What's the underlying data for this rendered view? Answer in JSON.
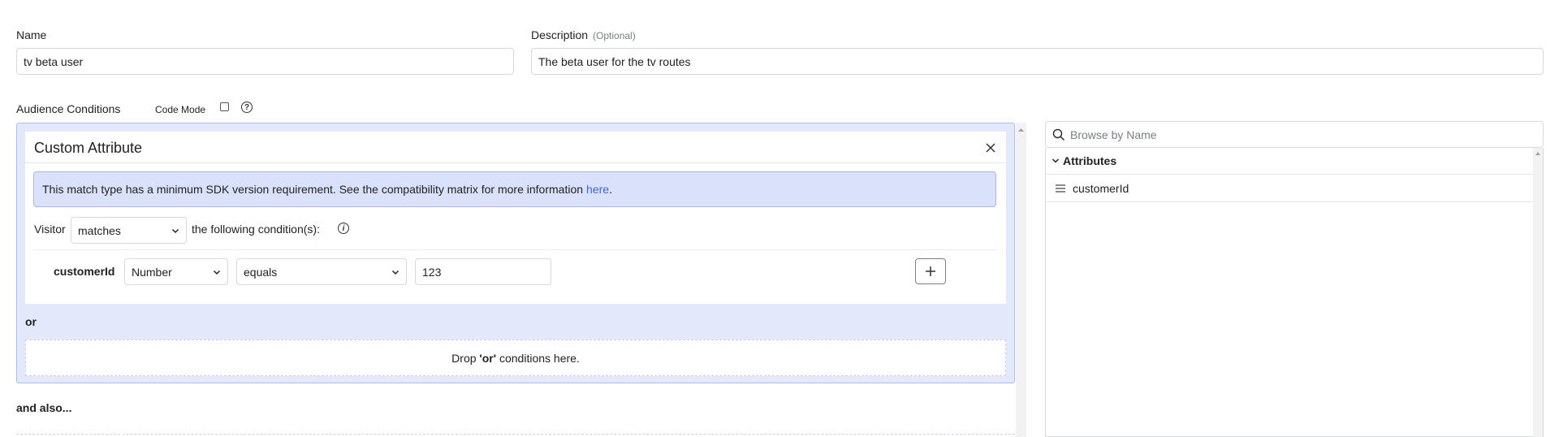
{
  "name_field": {
    "label": "Name",
    "value": "tv beta user"
  },
  "description_field": {
    "label": "Description",
    "optional_note": "(Optional)",
    "value": "The beta user for the tv routes"
  },
  "audience": {
    "label": "Audience Conditions",
    "code_mode_label": "Code Mode",
    "help_glyph": "?"
  },
  "condition_card": {
    "title": "Custom Attribute",
    "notice_text": "This match type has a minimum SDK version requirement. See the compatibility matrix for more information",
    "notice_link": "here",
    "notice_end": ".",
    "visitor_label": "Visitor",
    "match_select": "matches",
    "following_label": "the following condition(s):",
    "info_glyph": "i",
    "row": {
      "attribute": "customerId",
      "type_select": "Number",
      "operator_select": "equals",
      "value": "123"
    }
  },
  "or_label": "or",
  "drop_zone": {
    "prefix": "Drop ",
    "quoted": "'or'",
    "suffix": " conditions here."
  },
  "and_also_label": "and also...",
  "browser": {
    "search_placeholder": "Browse by Name",
    "section_label": "Attributes",
    "items": [
      "customerId"
    ]
  },
  "colors": {
    "accent": "#3e63dd",
    "container_bg": "#e3e9fb",
    "notice_bg": "#d9e1fb"
  }
}
